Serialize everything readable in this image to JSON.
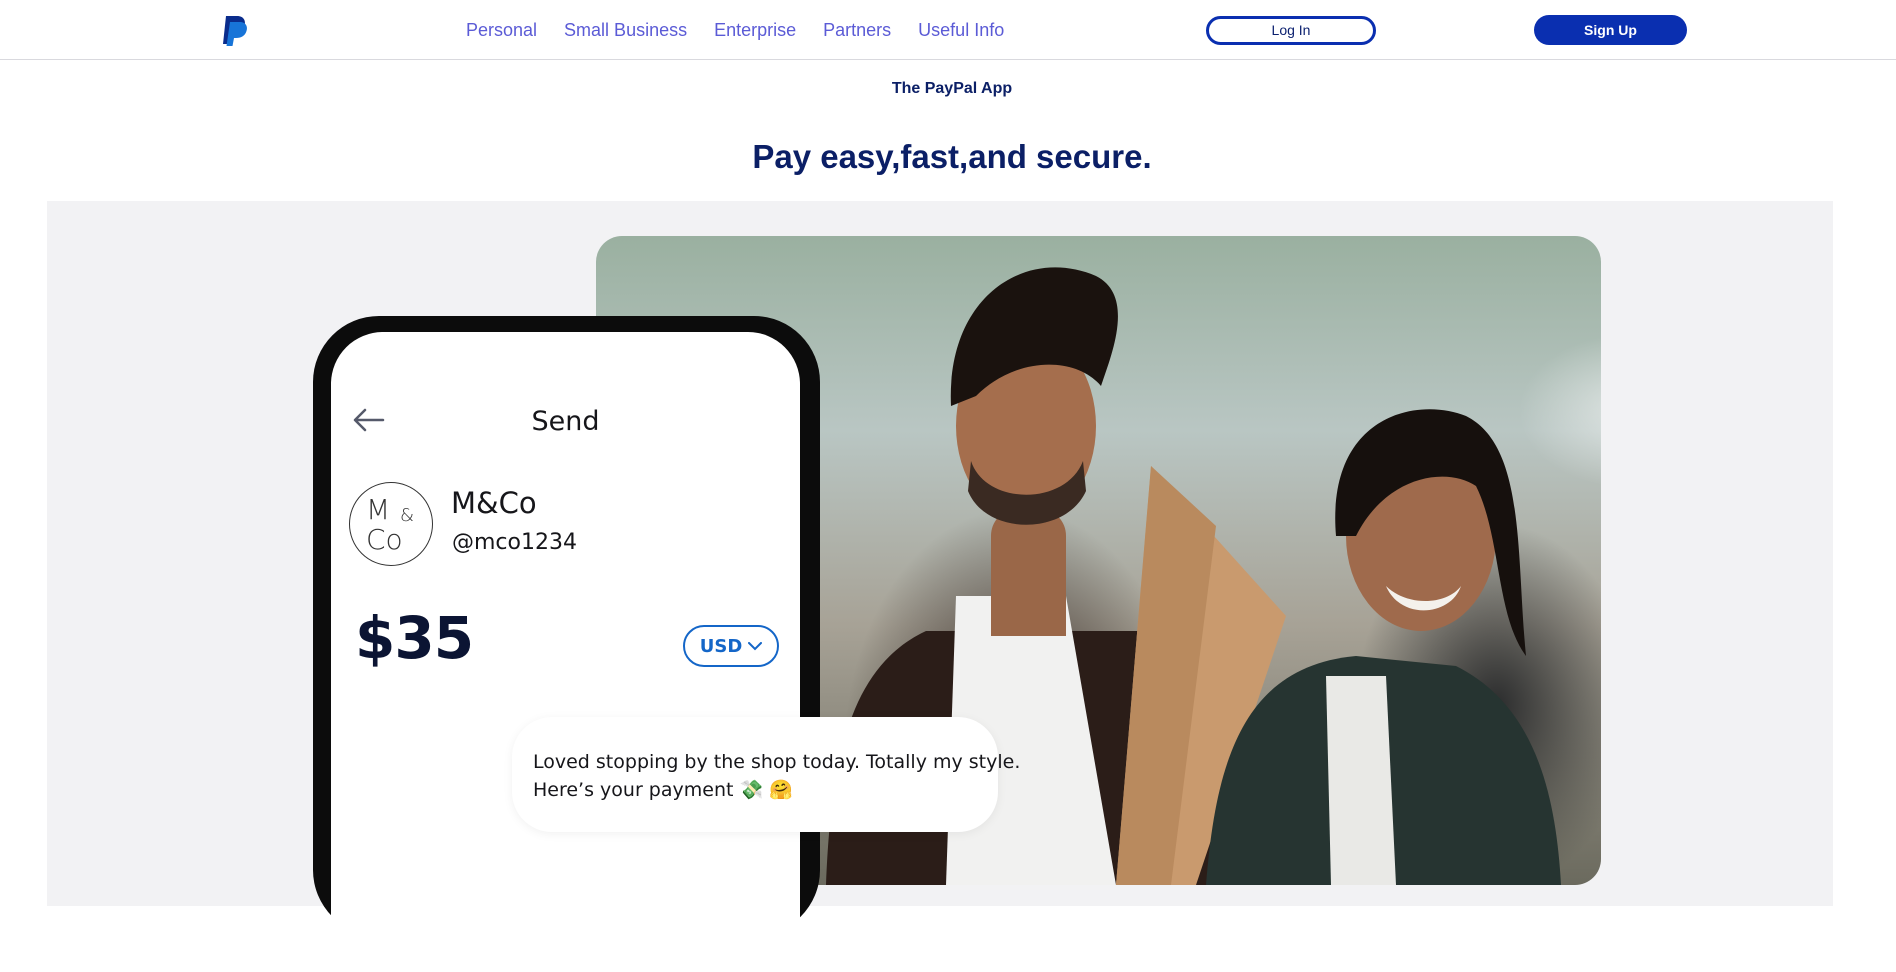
{
  "header": {
    "nav": [
      "Personal",
      "Small Business",
      "Enterprise",
      "Partners",
      "Useful Info"
    ],
    "login_label": "Log In",
    "signup_label": "Sign Up",
    "logo_icon": "paypal-logo-icon"
  },
  "hero": {
    "eyebrow": "The PayPal App",
    "headline": "Pay easy,fast,and secure."
  },
  "phone": {
    "title": "Send",
    "back_icon": "arrow-left-icon",
    "contact_logo_text": [
      "M",
      "&",
      "Co"
    ],
    "contact_name": "M&Co",
    "contact_handle": "@mco1234",
    "amount": "$35",
    "currency": "USD",
    "message_line1": "Loved stopping by the shop today. Totally my style.",
    "message_line2": "Here’s your payment 💸 🤗"
  },
  "colors": {
    "brand_blue": "#0a2fb0",
    "nav_link": "#5b5bd6",
    "heading_navy": "#0b1f66",
    "hero_bg": "#f2f2f4"
  }
}
